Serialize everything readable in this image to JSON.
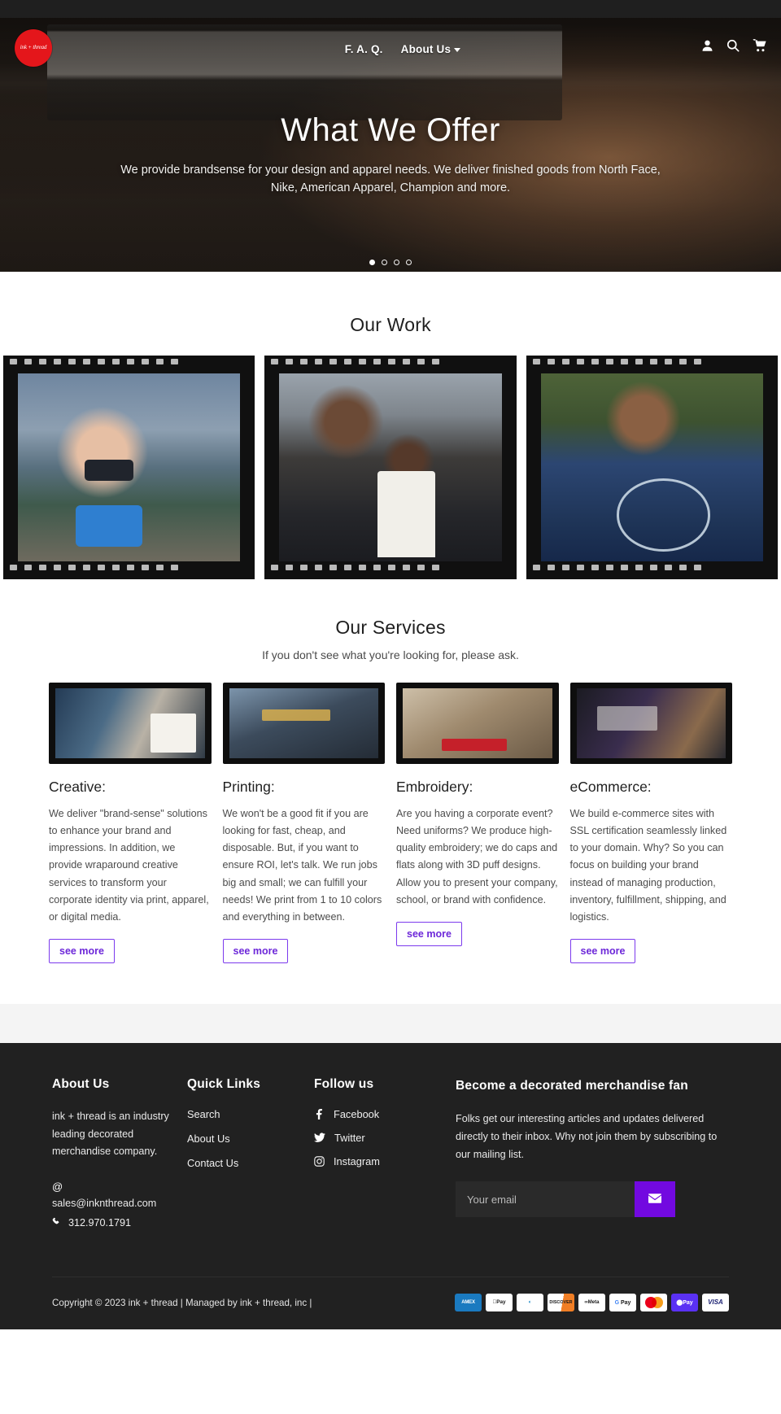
{
  "brand": {
    "logo_text": "ink + thread",
    "accent": "#7209e0",
    "logo_bg": "#e4161b"
  },
  "nav": {
    "links": [
      {
        "label": "F. A. Q.",
        "has_dropdown": false
      },
      {
        "label": "About Us",
        "has_dropdown": true
      }
    ],
    "icons": [
      {
        "name": "account-icon",
        "label": "Account"
      },
      {
        "name": "search-icon",
        "label": "Search"
      },
      {
        "name": "cart-icon",
        "label": "Cart"
      }
    ]
  },
  "hero": {
    "title": "What We Offer",
    "subtitle": "We provide brandsense for your design and apparel needs. We deliver finished goods from North Face, Nike, American Apparel, Champion and more.",
    "prev_arrow": "←",
    "next_arrow": "→",
    "slide_count": 4,
    "active_slide": 1
  },
  "our_work": {
    "title": "Our Work",
    "cards": [
      {
        "name": "work-card-mask",
        "alt": "Child wearing printed face mask holding a blue phone"
      },
      {
        "name": "work-card-greek",
        "alt": "Two people wearing Greek letter apparel"
      },
      {
        "name": "work-card-sweatshirt",
        "alt": "Woman in Epic Academy Legends crewneck with headphones"
      }
    ]
  },
  "our_services": {
    "title": "Our Services",
    "subtitle": "If you don't see what you're looking for, please ask.",
    "items": [
      {
        "title": "Creative:",
        "body": "We deliver \"brand-sense\" solutions to enhance your brand and impressions. In addition, we provide wraparound creative services to transform your corporate identity via print, apparel, or digital media.",
        "cta": "see more",
        "thumb_name": "creative-thumbnail"
      },
      {
        "title": "Printing:",
        "body": "We won't be a good fit if you are looking for fast, cheap, and disposable. But, if you want to ensure ROI, let's talk. We run jobs big and small; we can fulfill your needs! We print from 1 to 10 colors and everything in between.",
        "cta": "see more",
        "thumb_name": "printing-thumbnail"
      },
      {
        "title": "Embroidery:",
        "body": "Are you having a corporate event? Need uniforms? We produce high-quality embroidery; we do caps and flats along with 3D puff designs. Allow you to present your company, school, or brand with confidence.",
        "cta": "see more",
        "thumb_name": "embroidery-thumbnail"
      },
      {
        "title": "eCommerce:",
        "body": "We build e-commerce sites with SSL certification seamlessly linked to your domain. Why? So you can focus on building your brand instead of managing production, inventory, fulfillment, shipping, and logistics.",
        "cta": "see more",
        "thumb_name": "ecommerce-thumbnail"
      }
    ]
  },
  "footer": {
    "about": {
      "heading": "About Us",
      "body": "ink + thread is an industry leading decorated merchandise company.",
      "email": "sales@inknthread.com",
      "phone": "312.970.1791"
    },
    "quick_links": {
      "heading": "Quick Links",
      "links": [
        "Search",
        "About Us",
        "Contact Us"
      ]
    },
    "follow": {
      "heading": "Follow us",
      "links": [
        {
          "label": "Facebook",
          "icon": "facebook-icon"
        },
        {
          "label": "Twitter",
          "icon": "twitter-icon"
        },
        {
          "label": "Instagram",
          "icon": "instagram-icon"
        }
      ]
    },
    "newsletter": {
      "heading": "Become a decorated merchandise fan",
      "body": "Folks get our interesting articles and updates delivered directly to their inbox. Why not join them by subscribing to our mailing list.",
      "placeholder": "Your email",
      "value": "",
      "submit_icon": "envelope-icon"
    },
    "copyright": "Copyright © 2023 ink + thread | Managed by ink + thread, inc |",
    "payments": [
      {
        "name": "amex",
        "label": "AMEX"
      },
      {
        "name": "apple-pay",
        "label": "Pay"
      },
      {
        "name": "diners-club",
        "label": "Diners"
      },
      {
        "name": "discover",
        "label": "DISCOVER"
      },
      {
        "name": "meta-pay",
        "label": "Meta"
      },
      {
        "name": "google-pay",
        "label": "Pay"
      },
      {
        "name": "mastercard",
        "label": "Mastercard"
      },
      {
        "name": "shop-pay",
        "label": "Pay"
      },
      {
        "name": "visa",
        "label": "VISA"
      }
    ]
  }
}
